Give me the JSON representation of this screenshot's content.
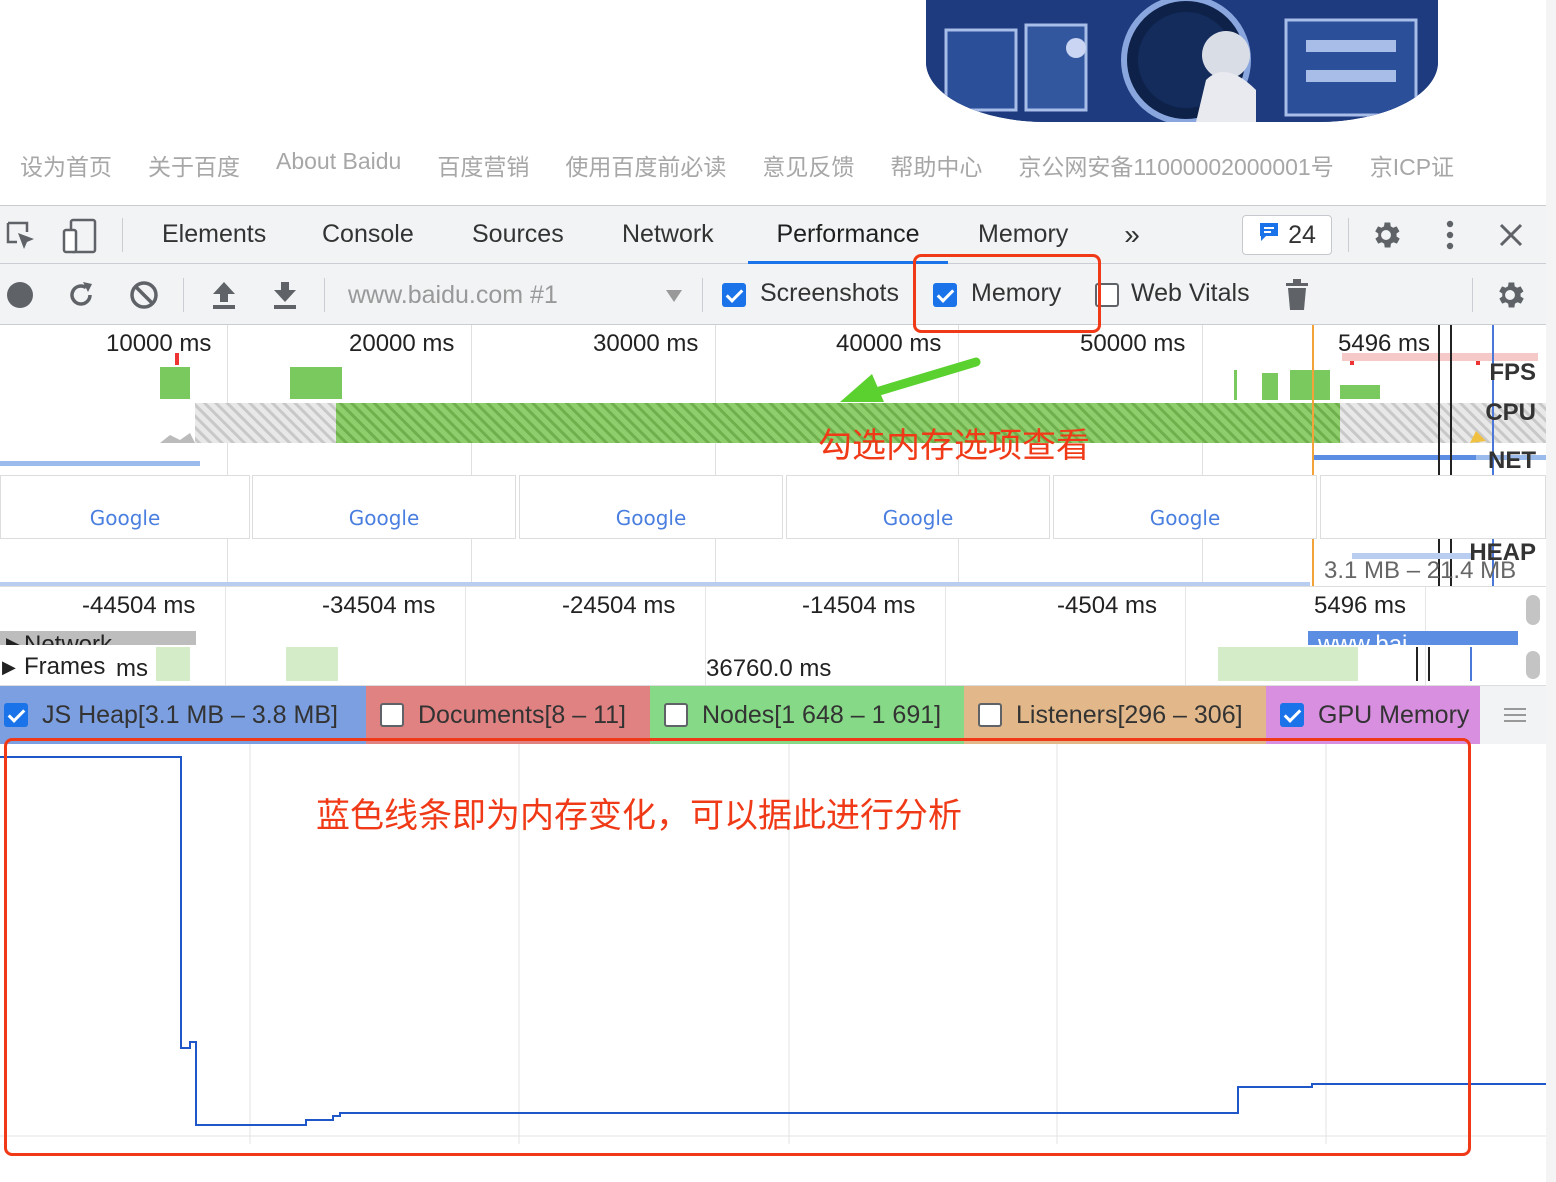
{
  "baidu": {
    "footer_links": [
      "设为首页",
      "关于百度",
      "About Baidu",
      "百度营销",
      "使用百度前必读",
      "意见反馈",
      "帮助中心",
      "京公网安备11000002000001号",
      "京ICP证"
    ]
  },
  "devtools": {
    "tabs": [
      "Elements",
      "Console",
      "Sources",
      "Network",
      "Performance",
      "Memory"
    ],
    "active_tab": "Performance",
    "more_tabs_icon": "chevron-double-right-icon",
    "issues_count": "24",
    "toolbar": {
      "recording_target": "www.baidu.com #1",
      "screenshots_label": "Screenshots",
      "screenshots_checked": true,
      "memory_label": "Memory",
      "memory_checked": true,
      "web_vitals_label": "Web Vitals",
      "web_vitals_checked": false
    },
    "overview": {
      "ticks": [
        "10000 ms",
        "20000 ms",
        "30000 ms",
        "40000 ms",
        "50000 ms",
        "5496 ms"
      ],
      "track_labels": [
        "FPS",
        "CPU",
        "NET",
        "HEAP"
      ],
      "heap_range": "3.1 MB – 21.4 MB",
      "screenshot_logo": "Google"
    },
    "timeline": {
      "ticks": [
        "-44504 ms",
        "-34504 ms",
        "-24504 ms",
        "-14504 ms",
        "-4504 ms",
        "5496 ms"
      ],
      "network_row_label": "Network",
      "network_url_fragment": "www.bai",
      "frames_row_label": "Frames",
      "frames_prefix_ms": "ms",
      "frame_duration": "36760.0 ms"
    },
    "counters": [
      {
        "label": "JS Heap[3.1 MB – 3.8 MB]",
        "checked": true,
        "color": "#7b9fe0"
      },
      {
        "label": "Documents[8 – 11]",
        "checked": false,
        "color": "#e08282"
      },
      {
        "label": "Nodes[1 648 – 1 691]",
        "checked": false,
        "color": "#86d986"
      },
      {
        "label": "Listeners[296 – 306]",
        "checked": false,
        "color": "#e2b88a"
      },
      {
        "label": "GPU Memory",
        "checked": true,
        "color": "#d88fe0"
      }
    ]
  },
  "annotations": {
    "memory_hint": "勾选内存选项查看",
    "graph_hint": "蓝色线条即为内存变化，可以据此进行分析"
  },
  "colors": {
    "accent": "#1a73e8",
    "annotation_red": "#f03a17",
    "annotation_arrow": "#5ad12e",
    "fps_green": "#6cc55a",
    "heap_line": "#1f57c9"
  }
}
